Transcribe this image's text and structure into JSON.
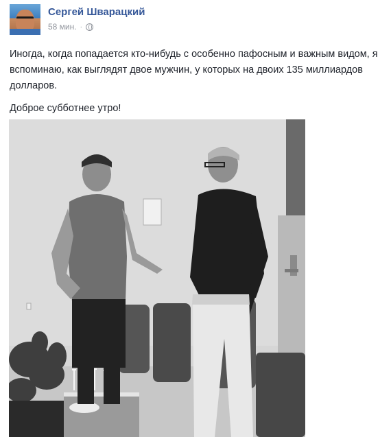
{
  "post": {
    "author": "Сергей Шварацкий",
    "timestamp": "58 мин.",
    "separator": "·",
    "privacy_icon": "globe-icon",
    "paragraphs": [
      "Иногда, когда попадается кто-нибудь с особенно пафосным и важным видом, я вспоминаю, как выглядят двое мужчин, у которых на двоих 135 миллиардов долларов.",
      "Доброе субботнее утро!"
    ]
  },
  "colors": {
    "author_link": "#365899",
    "meta_text": "#90949c",
    "body_text": "#1d2129"
  }
}
